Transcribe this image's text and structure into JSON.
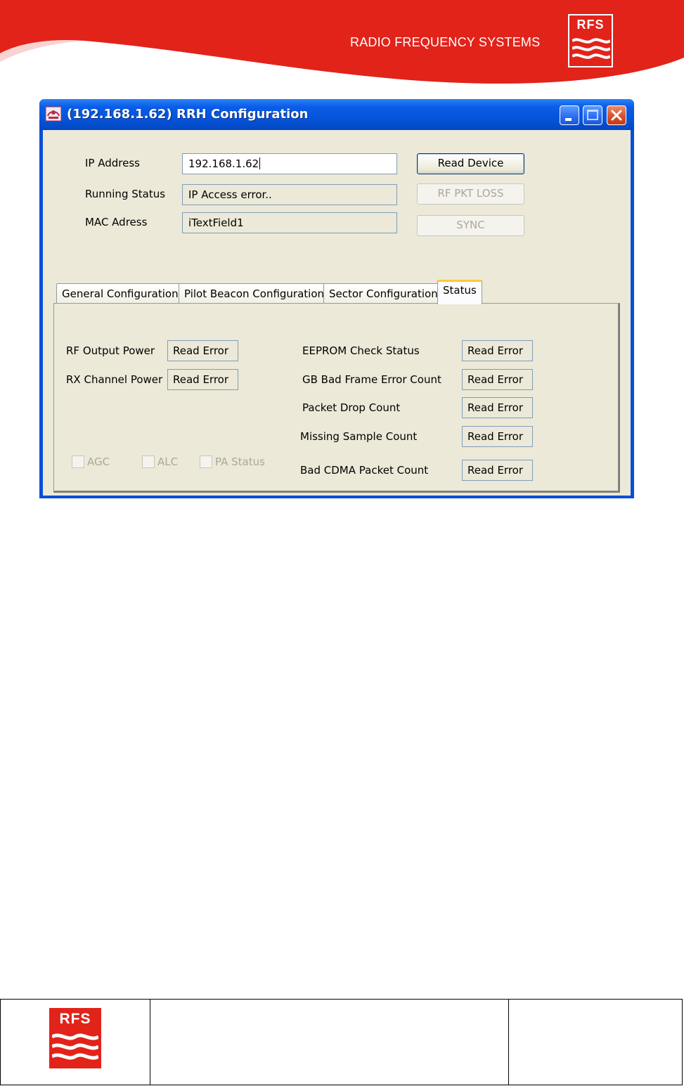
{
  "header": {
    "brand_text": "RADIO FREQUENCY SYSTEMS",
    "logo_letters": "RFS",
    "swoosh_color": "#e2231a"
  },
  "window": {
    "title": "(192.168.1.62) RRH Configuration",
    "titlebar_color": "#0552d6",
    "icons": [
      "app-icon",
      "minimize-icon",
      "maximize-icon",
      "close-icon"
    ]
  },
  "form": {
    "ip_address_label": "IP Address",
    "ip_address_value": "192.168.1.62",
    "running_status_label": "Running Status",
    "running_status_value": "IP Access error..",
    "mac_address_label": "MAC Adress",
    "mac_address_value": "iTextField1"
  },
  "buttons": {
    "read_device": "Read Device",
    "rf_pkt_loss": "RF PKT LOSS",
    "sync": "SYNC"
  },
  "tabs": [
    {
      "label": "General Configuration",
      "active": false
    },
    {
      "label": "Pilot Beacon Configuration",
      "active": false
    },
    {
      "label": "Sector Configuration",
      "active": false
    },
    {
      "label": "Status",
      "active": true
    }
  ],
  "status": {
    "rf_output_power": {
      "label": "RF Output Power",
      "value": "Read Error"
    },
    "rx_channel_power": {
      "label": "RX Channel Power",
      "value": "Read Error"
    },
    "eeprom_check_status": {
      "label": "EEPROM Check Status",
      "value": "Read Error"
    },
    "gb_bad_frame_error_count": {
      "label": "GB Bad Frame Error Count",
      "value": "Read Error"
    },
    "packet_drop_count": {
      "label": "Packet Drop Count",
      "value": "Read Error"
    },
    "missing_sample_count": {
      "label": "Missing Sample Count",
      "value": "Read Error"
    },
    "bad_cdma_packet_count": {
      "label": "Bad CDMA Packet Count",
      "value": "Read Error"
    },
    "checkboxes": [
      {
        "label": "AGC",
        "checked": false
      },
      {
        "label": "ALC",
        "checked": false
      },
      {
        "label": "PA Status",
        "checked": false
      }
    ]
  },
  "footer": {
    "logo_letters": "RFS"
  }
}
